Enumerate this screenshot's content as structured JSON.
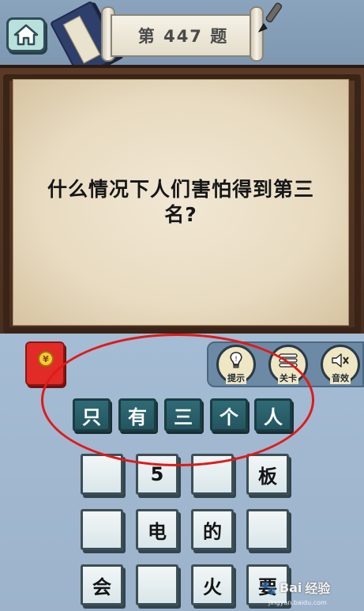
{
  "header": {
    "level_title": "第 447 题"
  },
  "question": {
    "text": "什么情况下人们害怕得到第三名?"
  },
  "tools": [
    {
      "label": "提示",
      "icon": "lightbulb-icon"
    },
    {
      "label": "关卡",
      "icon": "level-list-icon"
    },
    {
      "label": "音效",
      "icon": "speaker-mute-icon"
    }
  ],
  "red_packet": {
    "symbol": "¥"
  },
  "answer": [
    "只",
    "有",
    "三",
    "个",
    "人"
  ],
  "options": [
    [
      "",
      "",
      "5",
      "",
      "板"
    ],
    [
      "",
      "电",
      "的",
      ""
    ],
    [
      "会",
      "",
      "火",
      "要"
    ]
  ],
  "watermark": {
    "brand": "Bai",
    "text": "经验",
    "url": "jingyan.baidu.com"
  },
  "colors": {
    "answer_tile": "#2f6b75",
    "option_tile": "#e6eef0",
    "highlight": "#e01a1a",
    "paper": "#efe4cf",
    "board": "#4a2f20"
  }
}
